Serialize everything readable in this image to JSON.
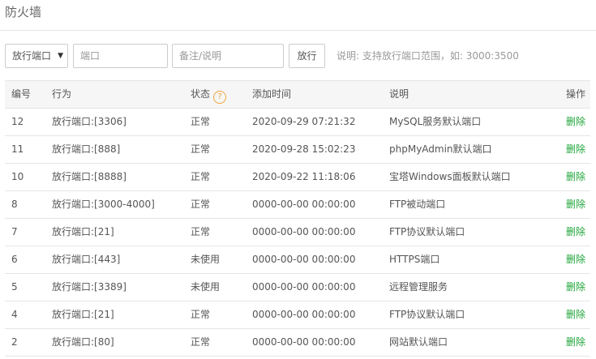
{
  "page": {
    "title": "防火墙"
  },
  "toolbar": {
    "select_value": "放行端口",
    "port_placeholder": "端口",
    "note_placeholder": "备注/说明",
    "submit_label": "放行",
    "hint": "说明: 支持放行端口范围，如: 3000:3500"
  },
  "table": {
    "headers": {
      "id": "编号",
      "action": "行为",
      "status": "状态",
      "time": "添加时间",
      "desc": "说明",
      "op": "操作"
    },
    "rows": [
      {
        "id": "12",
        "action": "放行端口:[3306]",
        "status": "正常",
        "time": "2020-09-29 07:21:32",
        "desc": "MySQL服务默认端口",
        "op": "删除"
      },
      {
        "id": "11",
        "action": "放行端口:[888]",
        "status": "正常",
        "time": "2020-09-28 15:02:23",
        "desc": "phpMyAdmin默认端口",
        "op": "删除"
      },
      {
        "id": "10",
        "action": "放行端口:[8888]",
        "status": "正常",
        "time": "2020-09-22 11:18:06",
        "desc": "宝塔Windows面板默认端口",
        "op": "删除"
      },
      {
        "id": "8",
        "action": "放行端口:[3000-4000]",
        "status": "正常",
        "time": "0000-00-00 00:00:00",
        "desc": "FTP被动端口",
        "op": "删除"
      },
      {
        "id": "7",
        "action": "放行端口:[21]",
        "status": "正常",
        "time": "0000-00-00 00:00:00",
        "desc": "FTP协议默认端口",
        "op": "删除"
      },
      {
        "id": "6",
        "action": "放行端口:[443]",
        "status": "未使用",
        "time": "0000-00-00 00:00:00",
        "desc": "HTTPS端口",
        "op": "删除"
      },
      {
        "id": "5",
        "action": "放行端口:[3389]",
        "status": "未使用",
        "time": "0000-00-00 00:00:00",
        "desc": "远程管理服务",
        "op": "删除"
      },
      {
        "id": "4",
        "action": "放行端口:[21]",
        "status": "正常",
        "time": "0000-00-00 00:00:00",
        "desc": "FTP协议默认端口",
        "op": "删除"
      },
      {
        "id": "2",
        "action": "放行端口:[80]",
        "status": "正常",
        "time": "0000-00-00 00:00:00",
        "desc": "网站默认端口",
        "op": "删除"
      }
    ]
  },
  "colors": {
    "accent_green": "#20a53a",
    "help_orange": "#f0a43a"
  },
  "icons": {
    "help": "help-icon",
    "dropdown": "dropdown-arrow-icon"
  }
}
